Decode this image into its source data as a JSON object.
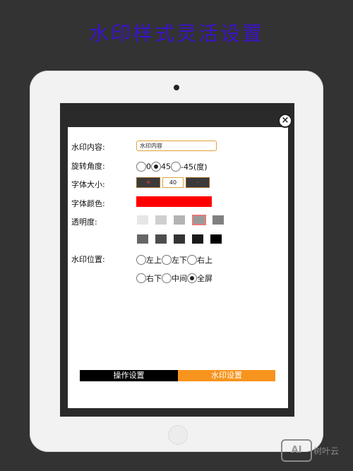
{
  "promo": {
    "title": "水印样式灵活设置"
  },
  "dialog": {
    "close_symbol": "×",
    "labels": {
      "content": "水印内容:",
      "rotation": "旋转角度:",
      "font_size": "字体大小:",
      "font_color": "字体颜色:",
      "opacity": "透明度:",
      "position": "水印位置:"
    },
    "content_value": "水印内容",
    "rotation_options": [
      {
        "label": "0",
        "checked": false
      },
      {
        "label": "45",
        "checked": true
      },
      {
        "label": "-45(度)",
        "checked": false
      }
    ],
    "font_size": {
      "minus": "+",
      "value": "40",
      "plus": "-"
    },
    "font_color": "#ff0000",
    "opacity_swatches_row1": [
      "#e6e6e6",
      "#cfcfcf",
      "#b3b3b3",
      "#9a9a9a",
      "#808080"
    ],
    "opacity_swatches_row2": [
      "#666666",
      "#4d4d4d",
      "#333333",
      "#1a1a1a",
      "#000000"
    ],
    "opacity_selected_index": 3,
    "position_options_row1": [
      {
        "label": "左上",
        "checked": false
      },
      {
        "label": "左下",
        "checked": false
      },
      {
        "label": "右上",
        "checked": false
      }
    ],
    "position_options_row2": [
      {
        "label": "右下",
        "checked": false
      },
      {
        "label": "中间",
        "checked": false
      },
      {
        "label": "全屏",
        "checked": true
      }
    ]
  },
  "tabs": {
    "operation": "操作设置",
    "watermark": "水印设置"
  },
  "watermark_logo": {
    "mark": "AI",
    "text": "树叶云"
  }
}
